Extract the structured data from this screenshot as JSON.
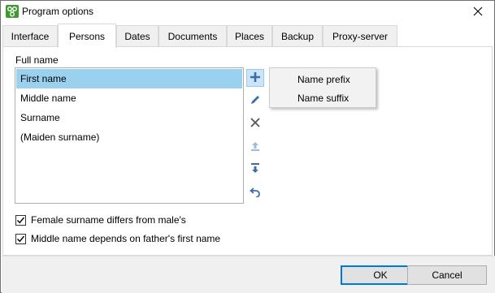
{
  "window": {
    "title": "Program options"
  },
  "tabs": [
    {
      "label": "Interface",
      "active": false
    },
    {
      "label": "Persons",
      "active": true
    },
    {
      "label": "Dates",
      "active": false
    },
    {
      "label": "Documents",
      "active": false
    },
    {
      "label": "Places",
      "active": false
    },
    {
      "label": "Backup",
      "active": false
    },
    {
      "label": "Proxy-server",
      "active": false
    }
  ],
  "fullname": {
    "label": "Full name",
    "items": [
      {
        "label": "First name",
        "selected": true
      },
      {
        "label": "Middle name",
        "selected": false
      },
      {
        "label": "Surname",
        "selected": false
      },
      {
        "label": "(Maiden surname)",
        "selected": false
      }
    ]
  },
  "toolbar": {
    "add": "plus-icon",
    "edit": "pencil-icon",
    "delete": "delete-x-icon",
    "move_up": "move-up-icon",
    "move_down": "move-down-icon",
    "reset": "undo-icon"
  },
  "add_menu": {
    "items": [
      "Name prefix",
      "Name suffix"
    ]
  },
  "options": [
    {
      "label": "Female surname differs from male's",
      "checked": true
    },
    {
      "label": "Middle name depends on father's first name",
      "checked": true
    }
  ],
  "buttons": {
    "ok": "OK",
    "cancel": "Cancel"
  },
  "colors": {
    "selection": "#99d1ee",
    "accent": "#0078d7",
    "icon_blue": "#3a6ea5",
    "app_icon_green": "#3c9a2f"
  }
}
